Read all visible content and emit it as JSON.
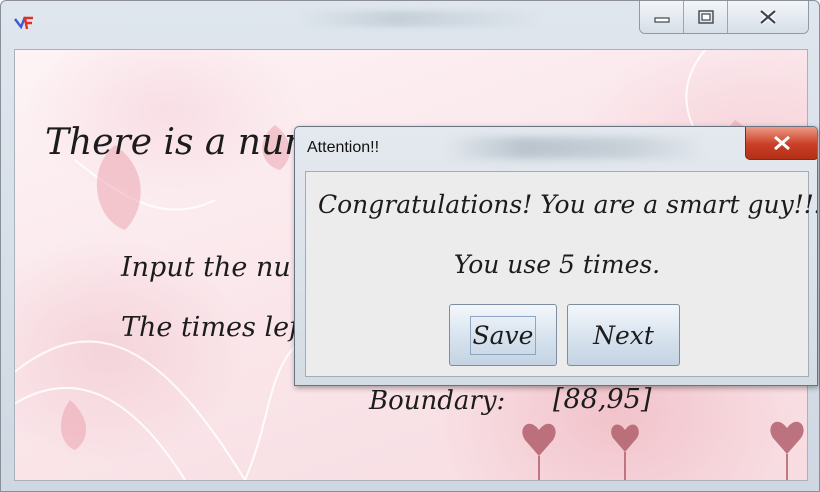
{
  "main_window": {
    "icon": "app-icon",
    "controls": [
      "minimize-icon",
      "maximize-icon",
      "close-icon"
    ],
    "content": {
      "headline": "There is a num",
      "input_label": "Input the nu",
      "times_left_label": "The times lef",
      "boundary_label": "Boundary:",
      "boundary_value": "[88,95]"
    }
  },
  "dialog": {
    "title": "Attention!!",
    "message": "Congratulations! You are a smart guy!!!",
    "times_used": "You use 5 times.",
    "buttons": {
      "save": "Save",
      "next": "Next"
    }
  },
  "colors": {
    "close_button": "#c93e26",
    "background_pink": "#f7dce1",
    "dialog_body": "#ececec"
  }
}
